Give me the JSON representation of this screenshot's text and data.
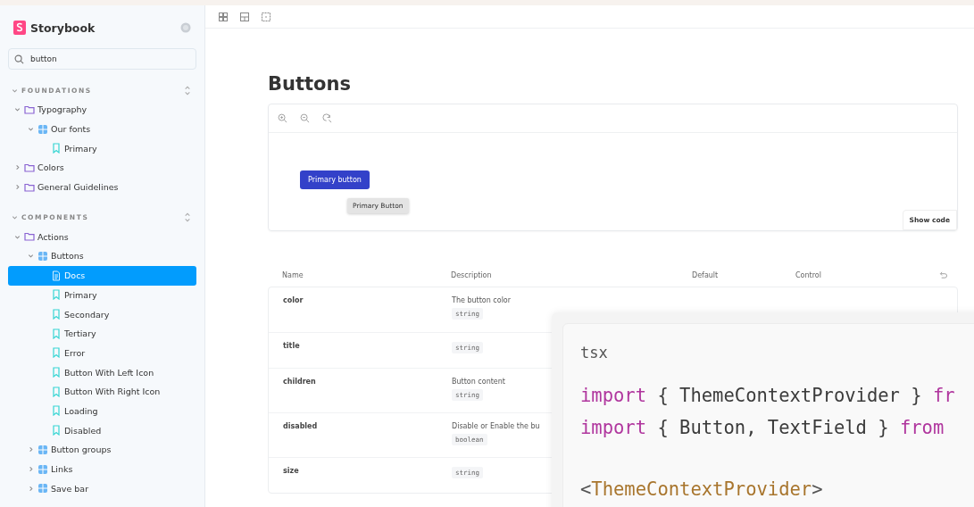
{
  "sidebar": {
    "brand": "Storybook",
    "search": {
      "value": "button"
    },
    "sections": [
      {
        "title": "FOUNDATIONS",
        "expanded": true,
        "items": [
          {
            "label": "Typography",
            "kind": "folder",
            "expanded": true,
            "selected": false,
            "children": [
              {
                "label": "Our fonts",
                "kind": "component",
                "expanded": true,
                "selected": false,
                "children": [
                  {
                    "label": "Primary",
                    "kind": "story",
                    "selected": false
                  }
                ]
              }
            ]
          },
          {
            "label": "Colors",
            "kind": "folder",
            "expanded": false,
            "selected": false
          },
          {
            "label": "General Guidelines",
            "kind": "folder",
            "expanded": false,
            "selected": false
          }
        ]
      },
      {
        "title": "COMPONENTS",
        "expanded": true,
        "items": [
          {
            "label": "Actions",
            "kind": "folder",
            "expanded": true,
            "selected": false,
            "children": [
              {
                "label": "Buttons",
                "kind": "component",
                "expanded": true,
                "selected": false,
                "children": [
                  {
                    "label": "Docs",
                    "kind": "docs",
                    "selected": true
                  },
                  {
                    "label": "Primary",
                    "kind": "story",
                    "selected": false
                  },
                  {
                    "label": "Secondary",
                    "kind": "story",
                    "selected": false
                  },
                  {
                    "label": "Tertiary",
                    "kind": "story",
                    "selected": false
                  },
                  {
                    "label": "Error",
                    "kind": "story",
                    "selected": false
                  },
                  {
                    "label": "Button With Left Icon",
                    "kind": "story",
                    "selected": false
                  },
                  {
                    "label": "Button With Right Icon",
                    "kind": "story",
                    "selected": false
                  },
                  {
                    "label": "Loading",
                    "kind": "story",
                    "selected": false
                  },
                  {
                    "label": "Disabled",
                    "kind": "story",
                    "selected": false
                  }
                ]
              },
              {
                "label": "Button groups",
                "kind": "component",
                "expanded": false,
                "selected": false
              },
              {
                "label": "Links",
                "kind": "component",
                "expanded": false,
                "selected": false
              },
              {
                "label": "Save bar",
                "kind": "component",
                "expanded": false,
                "selected": false
              }
            ]
          }
        ]
      }
    ]
  },
  "page": {
    "title": "Buttons",
    "preview": {
      "button": "Primary button",
      "tooltip": "Primary Button",
      "show_code": "Show code"
    },
    "table": {
      "columns": [
        "Name",
        "Description",
        "Default",
        "Control"
      ],
      "rows": [
        {
          "name": "color",
          "description": "The button color",
          "type": "string"
        },
        {
          "name": "title",
          "type": "string"
        },
        {
          "name": "children",
          "description": "Button content",
          "type": "string"
        },
        {
          "name": "disabled",
          "description": "Disable or Enable the bu",
          "type": "boolean"
        },
        {
          "name": "size",
          "type": "string"
        }
      ]
    }
  },
  "code": {
    "language": "tsx",
    "groups": [
      {
        "lines": [
          [
            {
              "kind": "keyword",
              "text": "import"
            },
            {
              "kind": "plain",
              "text": " { ThemeContextProvider } "
            },
            {
              "kind": "keyword",
              "text": "fr"
            }
          ],
          [
            {
              "kind": "keyword",
              "text": "import"
            },
            {
              "kind": "plain",
              "text": " { Button, TextField } "
            },
            {
              "kind": "keyword",
              "text": "from"
            }
          ]
        ]
      },
      {
        "lines": [
          [
            {
              "kind": "punct",
              "text": "<"
            },
            {
              "kind": "tag",
              "text": "ThemeContextProvider"
            },
            {
              "kind": "punct",
              "text": ">"
            }
          ]
        ]
      }
    ]
  }
}
